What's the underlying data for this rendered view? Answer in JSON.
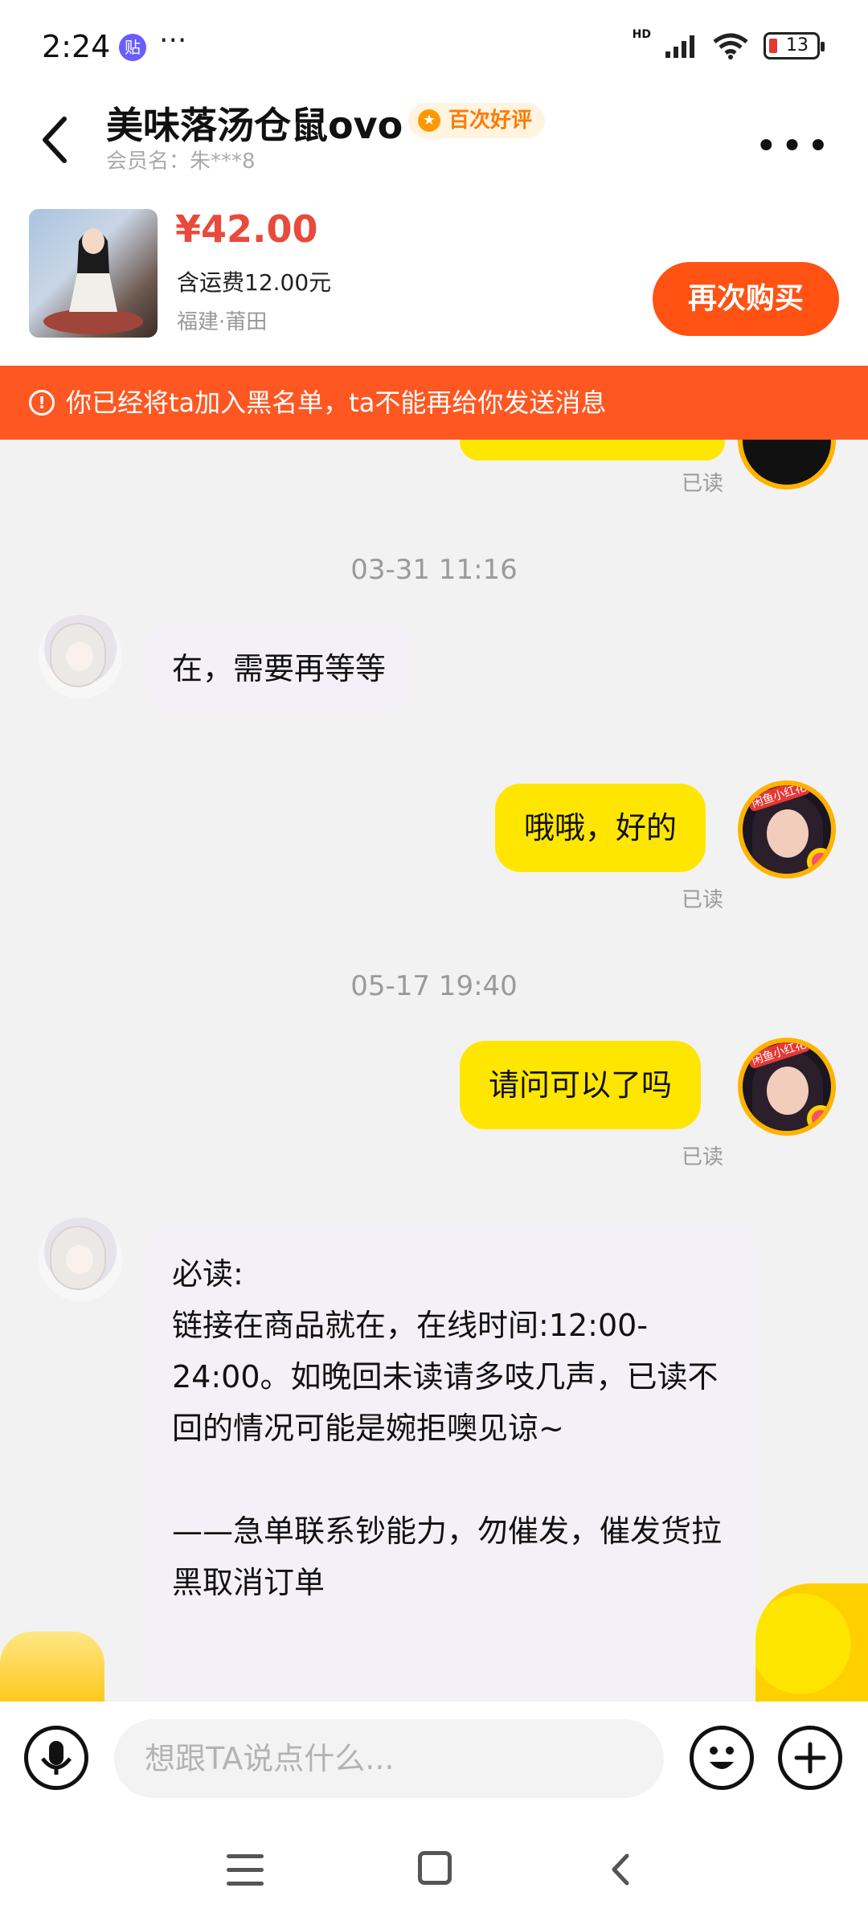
{
  "status_bar": {
    "time": "2:24",
    "app_icon_label": "贴",
    "more_dots": "···",
    "network": "HD",
    "battery": "13"
  },
  "header": {
    "seller_name": "美味落汤仓鼠ovo",
    "badge": "百次好评",
    "member_label": "会员名：朱***8",
    "icons": [
      "back-arrow-icon",
      "more-icon"
    ]
  },
  "product": {
    "price": "¥42.00",
    "shipping": "含运费12.00元",
    "location": "福建·莆田",
    "rebuy_label": "再次购买"
  },
  "banner": {
    "text": "你已经将ta加入黑名单，ta不能再给你发送消息",
    "icon": "warning-icon"
  },
  "chat": {
    "messages": [
      {
        "type": "read",
        "text": "已读"
      },
      {
        "type": "time",
        "text": "03-31 11:16"
      },
      {
        "type": "other",
        "text": "在，需要再等等"
      },
      {
        "type": "me",
        "text": "哦哦，好的"
      },
      {
        "type": "read",
        "text": "已读"
      },
      {
        "type": "time",
        "text": "05-17 19:40"
      },
      {
        "type": "me",
        "text": "请问可以了吗"
      },
      {
        "type": "read",
        "text": "已读"
      },
      {
        "type": "other",
        "text": "必读:\n链接在商品就在，在线时间:12:00-24:00。如晚回未读请多吱几声，已读不回的情况可能是婉拒噢见谅~\n\n——急单联系钞能力，勿催发，催发货拉黑取消订单"
      }
    ],
    "my_avatar_tag": "闲鱼小红花"
  },
  "input_bar": {
    "placeholder": "想跟TA说点什么..."
  },
  "colors": {
    "accent_orange": "#ff5213",
    "banner_orange": "#ff5722",
    "price_red": "#e84a3c",
    "my_bubble": "#ffe600",
    "other_bubble": "#f3f1f7"
  }
}
